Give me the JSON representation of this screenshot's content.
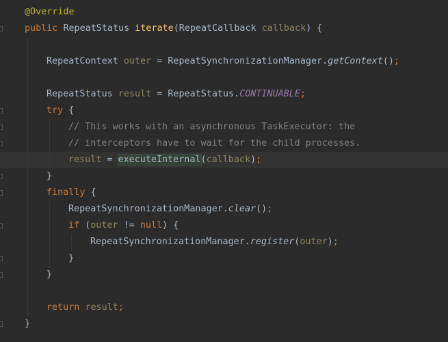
{
  "editor": {
    "lines": [
      {
        "indent": 0,
        "tokens": [
          {
            "t": "@Override",
            "c": "ann"
          }
        ]
      },
      {
        "indent": 0,
        "tokens": [
          {
            "t": "public ",
            "c": "kw"
          },
          {
            "t": "RepeatStatus ",
            "c": "ptxt"
          },
          {
            "t": "iterate",
            "c": "fn"
          },
          {
            "t": "(RepeatCallback ",
            "c": "ptxt"
          },
          {
            "t": "callback",
            "c": "param-dim"
          },
          {
            "t": ") {",
            "c": "ptxt"
          }
        ]
      },
      {
        "indent": 0,
        "tokens": []
      },
      {
        "indent": 1,
        "tokens": [
          {
            "t": "RepeatContext ",
            "c": "ptxt"
          },
          {
            "t": "outer",
            "c": "param-dim"
          },
          {
            "t": " = RepeatSynchronizationManager.",
            "c": "ptxt"
          },
          {
            "t": "getContext",
            "c": "ptxt italic"
          },
          {
            "t": "()",
            "c": "ptxt"
          },
          {
            "t": ";",
            "c": "sem"
          }
        ]
      },
      {
        "indent": 0,
        "tokens": []
      },
      {
        "indent": 1,
        "tokens": [
          {
            "t": "RepeatStatus ",
            "c": "ptxt"
          },
          {
            "t": "result",
            "c": "param-dim"
          },
          {
            "t": " = RepeatStatus.",
            "c": "ptxt"
          },
          {
            "t": "CONTINUABLE",
            "c": "const"
          },
          {
            "t": ";",
            "c": "sem"
          }
        ]
      },
      {
        "indent": 1,
        "tokens": [
          {
            "t": "try",
            "c": "kw"
          },
          {
            "t": " {",
            "c": "ptxt"
          }
        ]
      },
      {
        "indent": 2,
        "tokens": [
          {
            "t": "// This works with an asynchronous TaskExecutor: the",
            "c": "comment"
          }
        ]
      },
      {
        "indent": 2,
        "tokens": [
          {
            "t": "// interceptors have to wait for the child processes.",
            "c": "comment"
          }
        ]
      },
      {
        "indent": 2,
        "current": true,
        "tokens": [
          {
            "t": "result",
            "c": "param-dim"
          },
          {
            "t": " = ",
            "c": "ptxt"
          },
          {
            "t": "executeInte",
            "c": "ptxt usage"
          },
          {
            "caret": true
          },
          {
            "t": "rnal",
            "c": "ptxt usage"
          },
          {
            "t": "(",
            "c": "ptxt"
          },
          {
            "t": "callback",
            "c": "param-dim"
          },
          {
            "t": ")",
            "c": "ptxt"
          },
          {
            "t": ";",
            "c": "sem"
          }
        ]
      },
      {
        "indent": 1,
        "tokens": [
          {
            "t": "}",
            "c": "ptxt"
          }
        ]
      },
      {
        "indent": 1,
        "tokens": [
          {
            "t": "finally",
            "c": "kw"
          },
          {
            "t": " {",
            "c": "ptxt"
          }
        ]
      },
      {
        "indent": 2,
        "tokens": [
          {
            "t": "RepeatSynchronizationManager.",
            "c": "ptxt"
          },
          {
            "t": "clear",
            "c": "ptxt italic"
          },
          {
            "t": "()",
            "c": "ptxt"
          },
          {
            "t": ";",
            "c": "sem"
          }
        ]
      },
      {
        "indent": 2,
        "tokens": [
          {
            "t": "if",
            "c": "kw"
          },
          {
            "t": " (",
            "c": "ptxt"
          },
          {
            "t": "outer",
            "c": "param-dim"
          },
          {
            "t": " != ",
            "c": "ptxt"
          },
          {
            "t": "null",
            "c": "kw"
          },
          {
            "t": ") {",
            "c": "ptxt"
          }
        ]
      },
      {
        "indent": 3,
        "tokens": [
          {
            "t": "RepeatSynchronizationManager.",
            "c": "ptxt"
          },
          {
            "t": "register",
            "c": "ptxt italic"
          },
          {
            "t": "(",
            "c": "ptxt"
          },
          {
            "t": "outer",
            "c": "param-dim"
          },
          {
            "t": ")",
            "c": "ptxt"
          },
          {
            "t": ";",
            "c": "sem"
          }
        ]
      },
      {
        "indent": 2,
        "tokens": [
          {
            "t": "}",
            "c": "ptxt"
          }
        ]
      },
      {
        "indent": 1,
        "tokens": [
          {
            "t": "}",
            "c": "ptxt"
          }
        ]
      },
      {
        "indent": 0,
        "tokens": []
      },
      {
        "indent": 1,
        "tokens": [
          {
            "t": "return ",
            "c": "kw"
          },
          {
            "t": "result",
            "c": "param-dim"
          },
          {
            "t": ";",
            "c": "sem"
          }
        ]
      },
      {
        "indent": 0,
        "tokens": [
          {
            "t": "}",
            "c": "ptxt"
          }
        ]
      }
    ]
  },
  "colors": {
    "background": "#2b2b2b",
    "keyword": "#cc7832",
    "annotation": "#bbb529",
    "method_declaration": "#ffc66d",
    "comment": "#808080",
    "constant": "#9876aa",
    "plain_text": "#a9b7c6"
  }
}
